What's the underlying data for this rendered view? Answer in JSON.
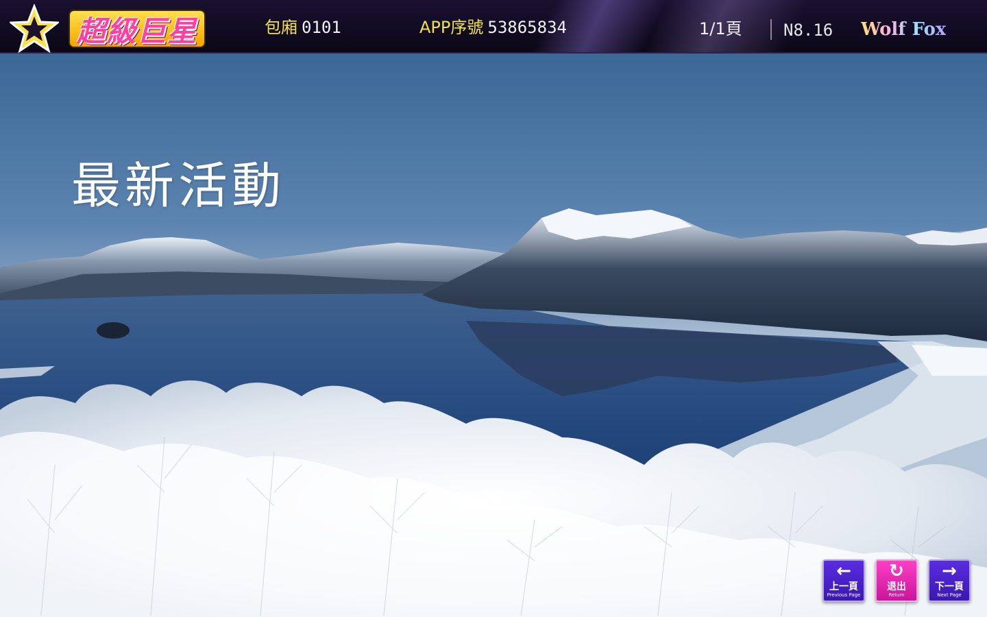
{
  "header": {
    "logo_text": "超級巨星",
    "room_label": "包廂",
    "room_value": "0101",
    "app_label": "APP序號",
    "app_value": "53865834",
    "page_indicator": "1/1頁",
    "version": "N8.16",
    "brand": "Wolf Fox"
  },
  "main": {
    "title": "最新活動"
  },
  "nav": {
    "prev": {
      "glyph": "←",
      "label": "上一頁",
      "sublabel": "Previous Page"
    },
    "return": {
      "glyph": "↻",
      "label": "退出",
      "sublabel": "Return"
    },
    "next": {
      "glyph": "→",
      "label": "下一頁",
      "sublabel": "Next Page"
    }
  },
  "colors": {
    "header_bg": "#0a0818",
    "header_label": "#f2e24a",
    "nav_purple": "#4a20c8",
    "nav_pink": "#e82ab0",
    "sky": "#3b6796",
    "lake": "#1f3f72"
  }
}
